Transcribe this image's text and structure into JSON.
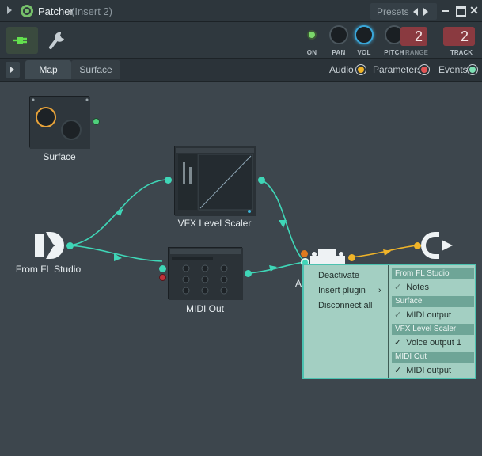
{
  "window": {
    "title": "Patcher",
    "subtitle": "(Insert 2)",
    "presets_label": "Presets",
    "close_glyph": "✕"
  },
  "toolbar": {
    "knobs": [
      {
        "label": "ON"
      },
      {
        "label": "PAN"
      },
      {
        "label": "VOL"
      },
      {
        "label": "PITCH"
      }
    ],
    "range_label": "RANGE",
    "range_value": "2",
    "track_label": "TRACK",
    "track_value": "2"
  },
  "tabs": {
    "map": "Map",
    "surface": "Surface"
  },
  "legend": {
    "audio": "Audio",
    "parameters": "Parameters",
    "events": "Events"
  },
  "nodes": {
    "surface": "Surface",
    "vfx": "VFX Level Scaler",
    "from_fl": "From FL Studio",
    "midi_out": "MIDI Out",
    "partial_label": "A"
  },
  "context_menu": {
    "items": [
      "Deactivate",
      "Insert plugin",
      "Disconnect all"
    ],
    "submenu_arrow": "›",
    "groups": [
      {
        "header": "From FL Studio",
        "item": "Notes",
        "checked": false
      },
      {
        "header": "Surface",
        "item": "MIDI output",
        "checked": false
      },
      {
        "header": "VFX Level Scaler",
        "item": "Voice output 1",
        "checked": true
      },
      {
        "header": "MIDI Out",
        "item": "MIDI output",
        "checked": true
      }
    ],
    "check_glyph": "✓"
  },
  "colors": {
    "audio": "#f0b429",
    "parameters": "#e05555",
    "events": "#7ee0b4",
    "wire_events": "#3fd6b7",
    "wire_audio": "#f0b429",
    "accent_green": "#76c06a"
  }
}
